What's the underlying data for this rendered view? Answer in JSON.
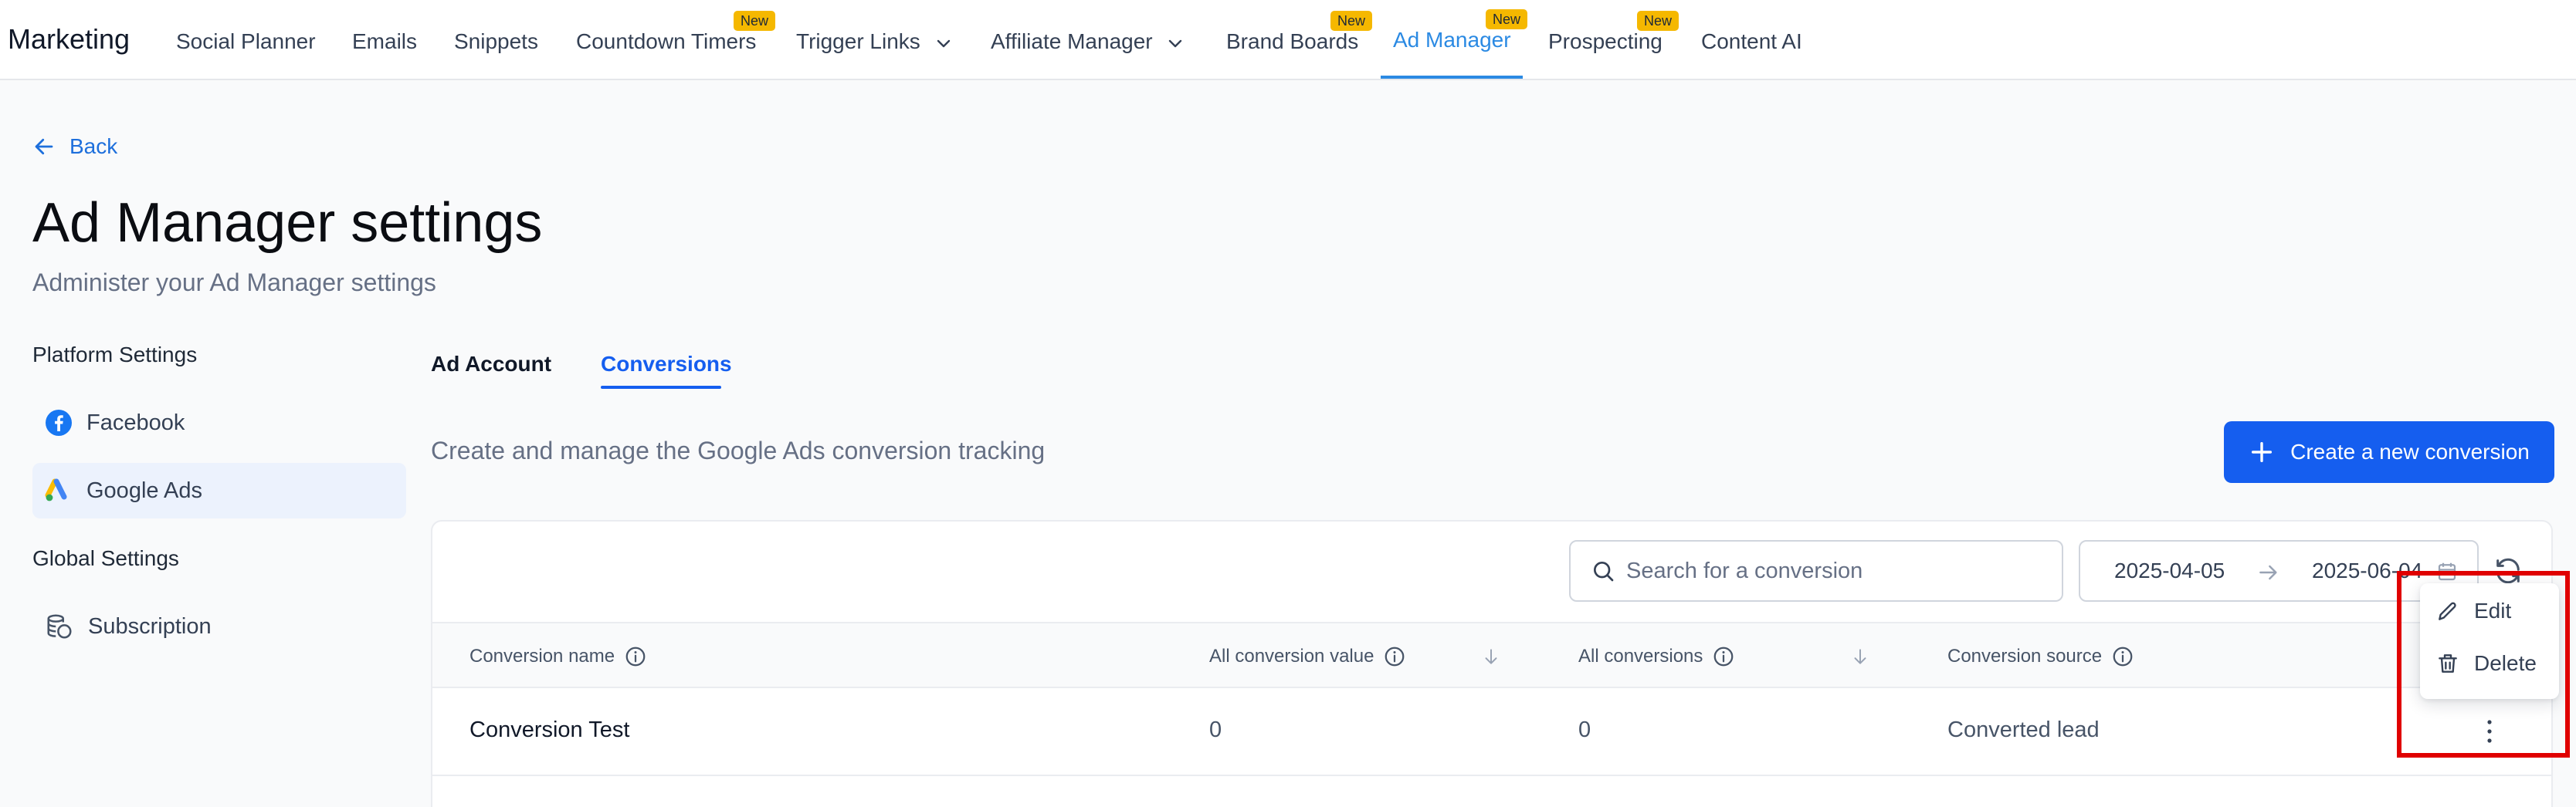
{
  "app": {
    "name": "Marketing"
  },
  "nav": {
    "items": [
      {
        "label": "Social Planner"
      },
      {
        "label": "Emails"
      },
      {
        "label": "Snippets"
      },
      {
        "label": "Countdown Timers",
        "badge": "New"
      },
      {
        "label": "Trigger Links",
        "dropdown": true
      },
      {
        "label": "Affiliate Manager",
        "dropdown": true
      },
      {
        "label": "Brand Boards",
        "badge": "New"
      },
      {
        "label": "Ad Manager",
        "badge": "New",
        "active": true
      },
      {
        "label": "Prospecting",
        "badge": "New"
      },
      {
        "label": "Content AI"
      }
    ]
  },
  "header": {
    "back_label": "Back",
    "title": "Ad Manager settings",
    "subtitle": "Administer your Ad Manager settings"
  },
  "sidebar": {
    "platform_heading": "Platform Settings",
    "platform_items": [
      {
        "label": "Facebook",
        "icon": "facebook-icon"
      },
      {
        "label": "Google Ads",
        "icon": "google-ads-icon",
        "active": true
      }
    ],
    "global_heading": "Global Settings",
    "global_items": [
      {
        "label": "Subscription",
        "icon": "subscription-icon"
      }
    ]
  },
  "tabs": [
    {
      "label": "Ad Account"
    },
    {
      "label": "Conversions",
      "active": true
    }
  ],
  "conversions": {
    "description": "Create and manage the Google Ads conversion tracking",
    "create_button": "Create a new conversion",
    "search_placeholder": "Search for a conversion",
    "date_start": "2025-04-05",
    "date_end": "2025-06-04",
    "columns": [
      {
        "label": "Conversion name"
      },
      {
        "label": "All conversion value"
      },
      {
        "label": "All conversions"
      },
      {
        "label": "Conversion source"
      }
    ],
    "rows": [
      {
        "name": "Conversion Test",
        "value": "0",
        "conversions": "0",
        "source": "Converted lead"
      }
    ],
    "row_menu": {
      "edit": "Edit",
      "delete": "Delete"
    }
  },
  "colors": {
    "accent": "#155eef",
    "nav_active": "#2b8ae3",
    "badge": "#f5b800",
    "highlight_box": "#e00000"
  }
}
